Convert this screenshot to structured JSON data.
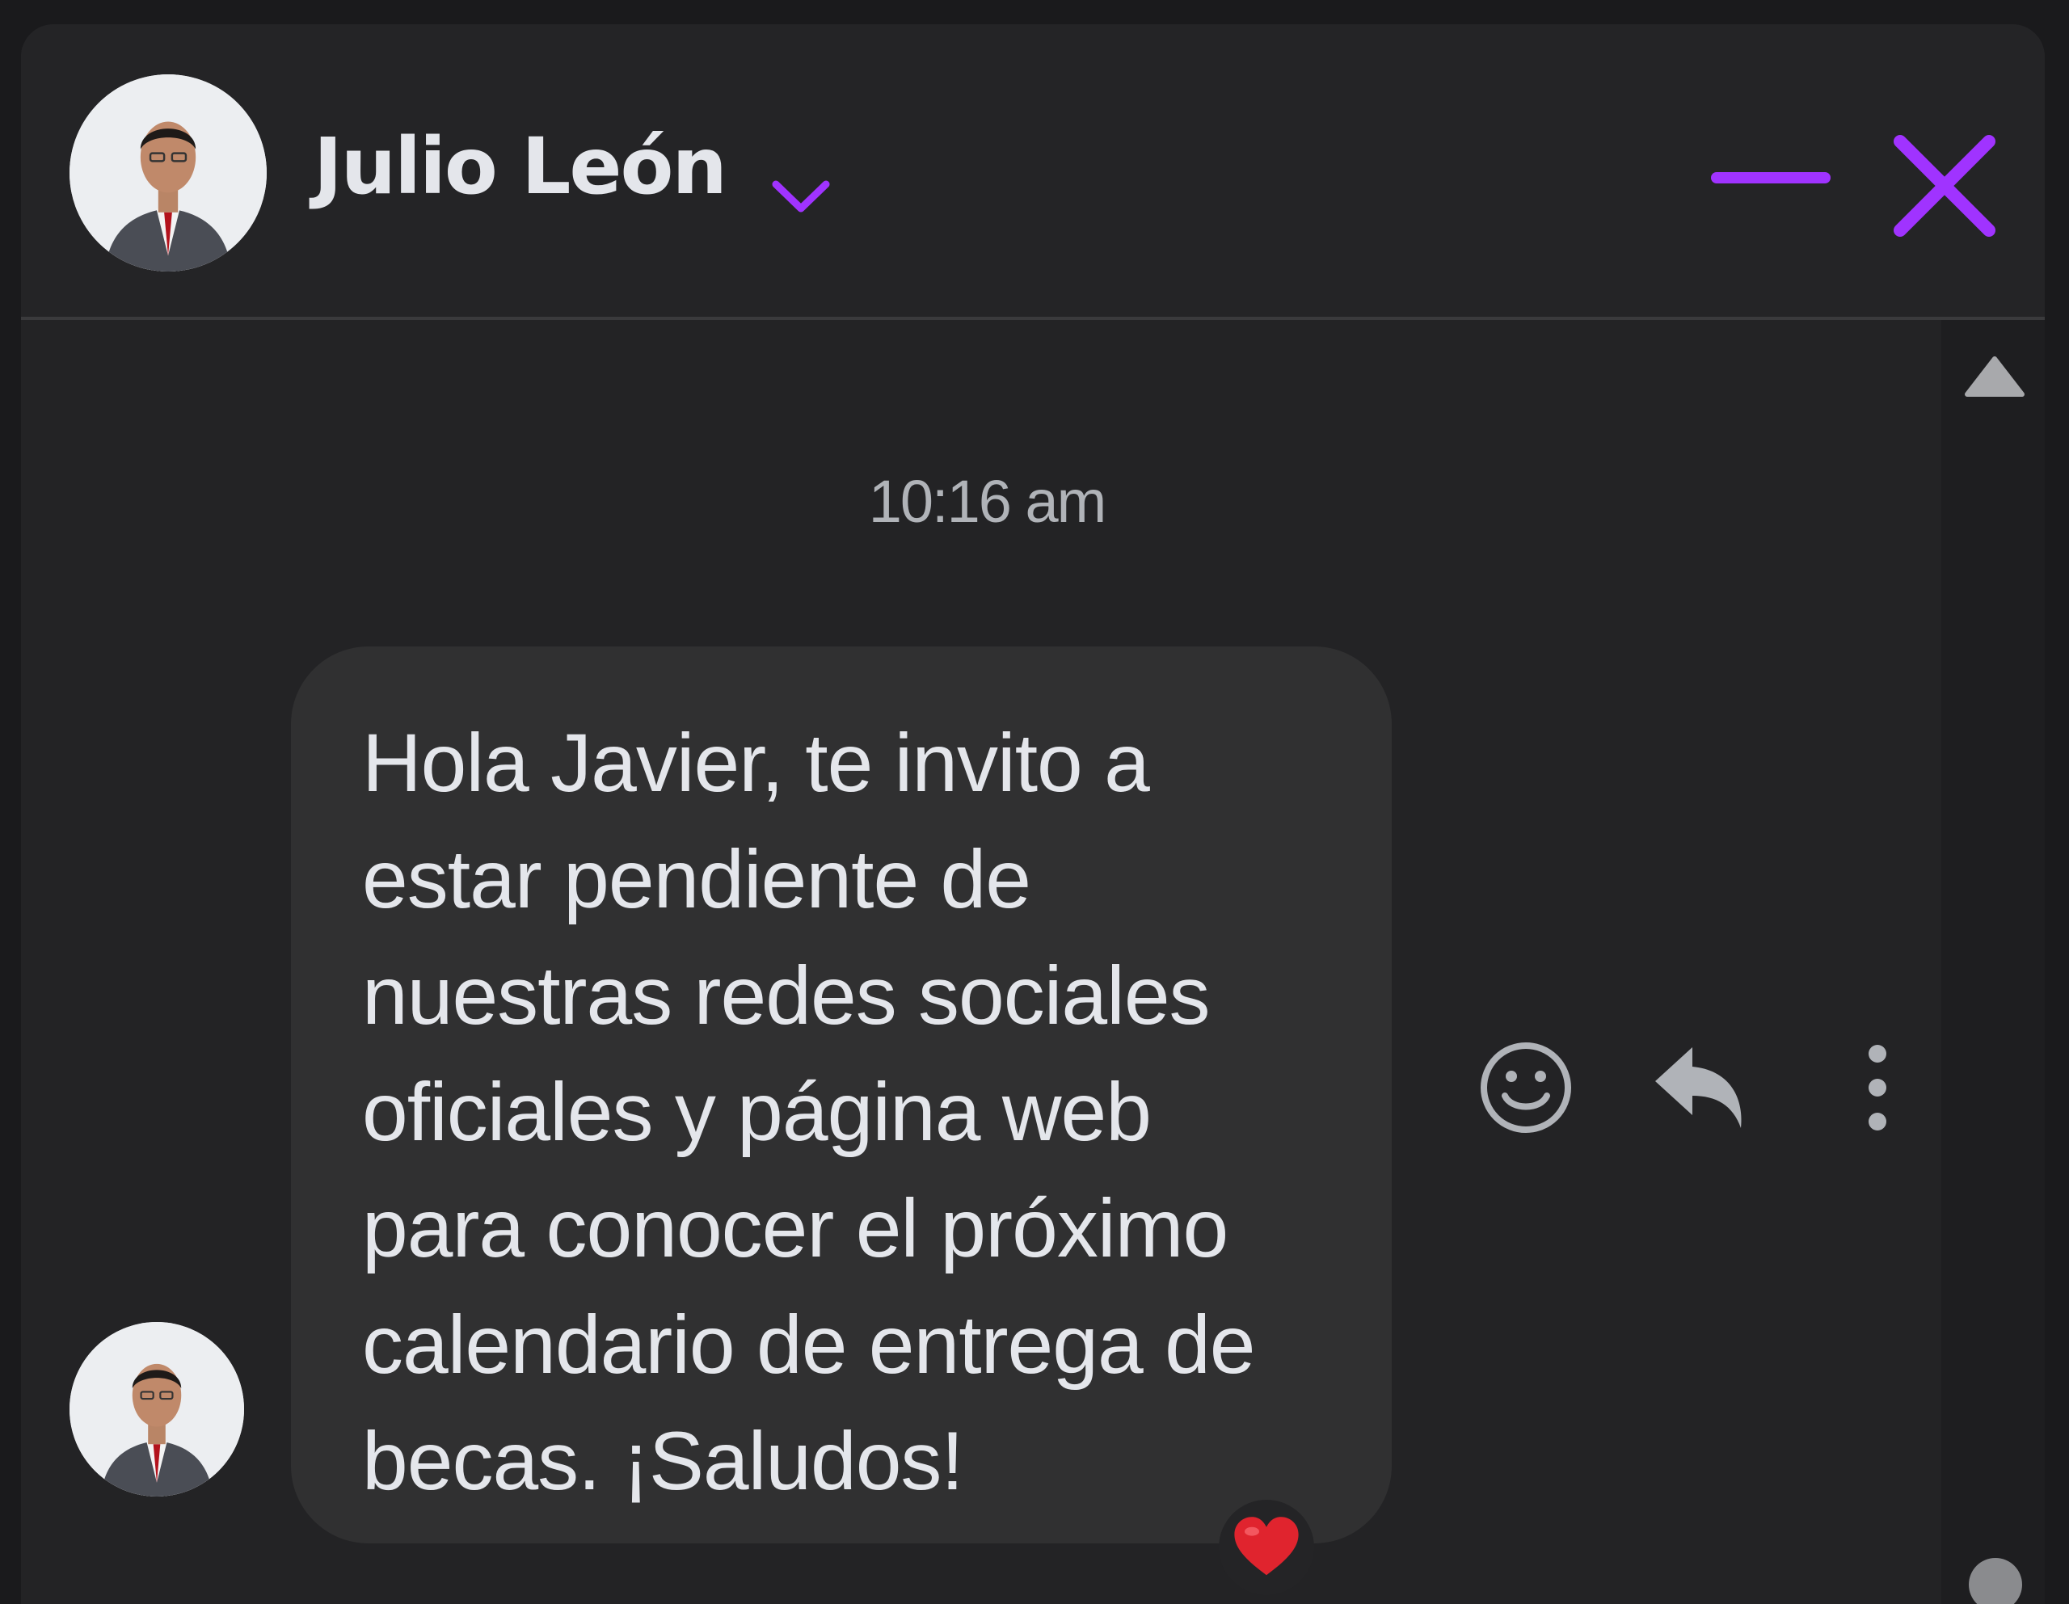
{
  "header": {
    "contact_name": "Julio León",
    "avatar_icon": "person-avatar",
    "chevron_icon": "chevron-down-icon",
    "minimize_icon": "minimize-icon",
    "close_icon": "close-icon"
  },
  "conversation": {
    "timestamp": "10:16 am",
    "messages": [
      {
        "text": "Hola Javier, te invito a\nestar pendiente de\nnuestras redes sociales\noficiales y página web\npara conocer el próximo\ncalendario de entrega de\nbecas. ¡Saludos!",
        "reaction": "❤️"
      }
    ]
  },
  "actions": {
    "react_icon": "smiley-icon",
    "reply_icon": "reply-icon",
    "more_icon": "more-vertical-icon"
  },
  "colors": {
    "accent": "#a033ff",
    "background": "#232325",
    "bubble": "#303031",
    "text": "#e4e6eb",
    "muted": "#b0b3b8"
  }
}
